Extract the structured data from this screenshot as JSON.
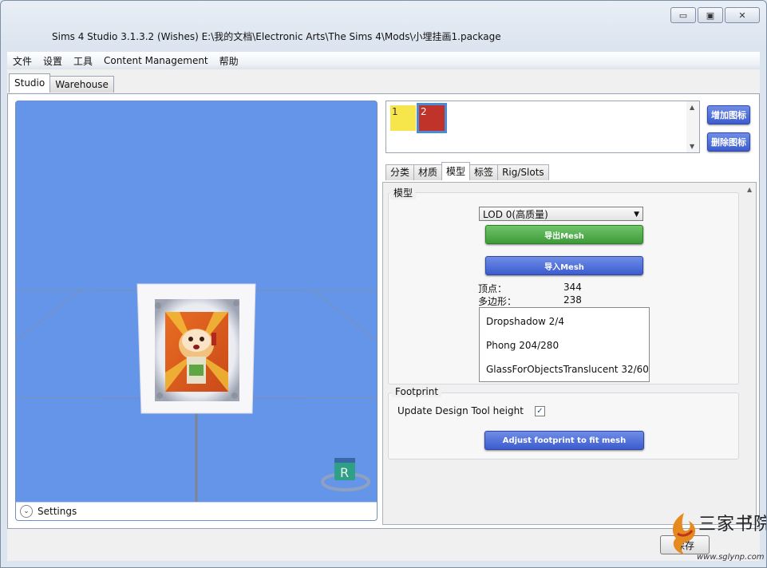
{
  "window": {
    "title": "Sims 4 Studio 3.1.3.2 (Wishes)  E:\\我的文档\\Electronic Arts\\The Sims 4\\Mods\\小埋挂画1.package",
    "minimize": "▭",
    "maximize": "▣",
    "close": "✕"
  },
  "menu": [
    "文件",
    "设置",
    "工具",
    "Content Management",
    "帮助"
  ],
  "top_tabs": [
    "Studio",
    "Warehouse"
  ],
  "viewport": {
    "settings_label": "Settings",
    "expander": "⌄",
    "r_marker": "R"
  },
  "swatches": {
    "items": [
      "1",
      "2"
    ],
    "colors": [
      "#f7e64b",
      "#c0332b"
    ],
    "scroll_up": "▲",
    "scroll_down": "▼"
  },
  "side_buttons": {
    "add": "增加图标",
    "remove": "删除图标"
  },
  "inner_tabs": [
    "分类",
    "材质",
    "模型",
    "标签",
    "Rig/Slots"
  ],
  "model": {
    "group_label": "模型",
    "lod_selected": "LOD 0(高质量)",
    "export_btn": "导出Mesh",
    "import_btn": "导入Mesh",
    "vertices_label": "顶点：",
    "vertices_value": "344",
    "polygons_label": "多边形：",
    "polygons_value": "238",
    "shaders": [
      "Dropshadow 2/4",
      "Phong 204/280",
      "GlassForObjectsTranslucent 32/60"
    ]
  },
  "footprint": {
    "group_label": "Footprint",
    "update_label": "Update Design Tool height",
    "update_checked": "✓",
    "adjust_btn": "Adjust footprint to fit mesh"
  },
  "inner_scroll": {
    "up": "▲",
    "down": "▼"
  },
  "bottom": {
    "save": "保存"
  },
  "watermark": {
    "text": "三家书院",
    "url": "www.sglynp.com"
  },
  "colors": {
    "viewport_bg": "#6595e9",
    "accent_blue": "#3c5ccf",
    "accent_green": "#3d9b37"
  }
}
